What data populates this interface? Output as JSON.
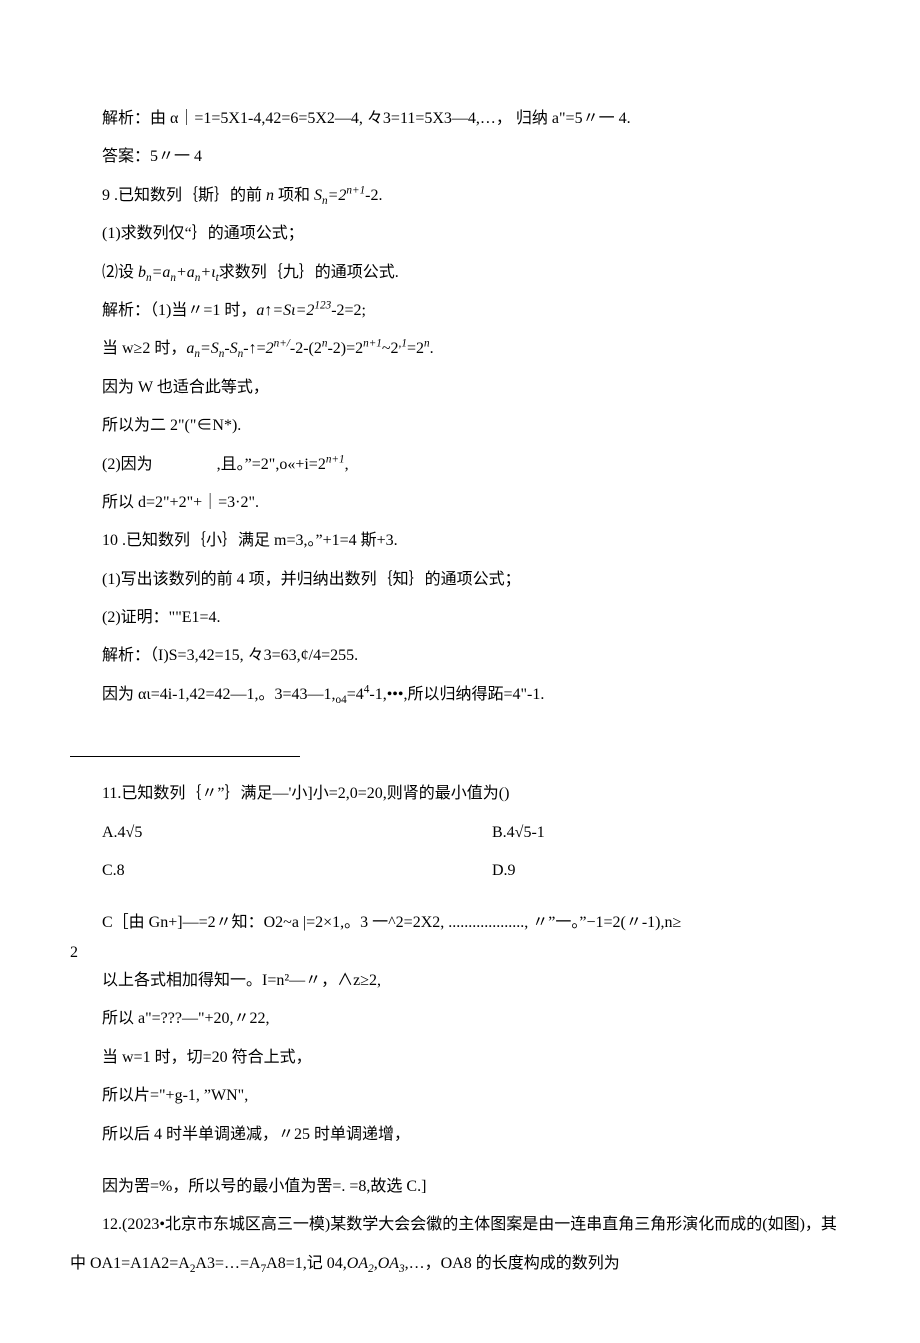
{
  "p01": "解析：由 α｜=1=5X1-4,42=6=5X2—4, 々3=11=5X3—4,…， 归纳 a\"=5〃一 4.",
  "p02": "答案：5〃一 4",
  "p03_a": "9 .已知数列｛斯｝的前 ",
  "p03_b": " 项和 ",
  "p03_c": "-2.",
  "p04": "(1)求数列仅“｝的通项公式；",
  "p05_a": "⑵设 ",
  "p05_b": "求数列｛九｝的通项公式.",
  "p06_a": "解析：（1)当〃=1 时，",
  "p06_b": "-2=2;",
  "p07_a": "当 w≥2 时，",
  "p07_b": "-↑=",
  "p07_c": "-2-(2",
  "p07_d": "-2)=2",
  "p07_e": "~2",
  "p07_f": "=2",
  "p07_g": ".",
  "p08": "因为 W 也适合此等式，",
  "p09": "所以为二 2\"(\"∈N*).",
  "p10_a": "(2)因为",
  "p10_b": ",且。”=2\",o«+i=2",
  "p10_c": ",",
  "p11": "所以 d=2\"+2\"+｜=3·2\".",
  "p12": "10 .已知数列｛小｝满足 m=3,。”+1=4 斯+3.",
  "p13": "(1)写出该数列的前 4 项，并归纳出数列｛知｝的通项公式；",
  "p14": "(2)证明：\"\"E1=4.",
  "p15": "解析：（I)S=3,42=15, 々3=63,¢/4=255.",
  "p16_a": "因为 αι=4i-1,42=42—1,。3=43—1,",
  "p16_b": "=4",
  "p16_c": "-1,•••,所以归纳得跖=4\"-1.",
  "q11_stem": "11.已知数列｛〃”｝满足—'小]小=2,0=20,则肾的最小值为()",
  "q11_A": "A.4√5",
  "q11_B": "B.4√5-1",
  "q11_C": "C.8",
  "q11_D": "D.9",
  "q11_sol1": "C［由 Gn+]—=2〃知：O2~a |=2×1,。3 一^2=2X2, ..................., 〃”一。”−1=2(〃-1),n≥",
  "q11_sol1_tail": "2",
  "q11_sol2": "以上各式相加得知一。I=n²—〃，∧z≥2,",
  "q11_sol3": "所以 a\"=???—\"+20,〃22,",
  "q11_sol4": "当 w=1 时，切=20 符合上式，",
  "q11_sol5": "所以片=\"+g-1, ”WN\",",
  "q11_sol6": "所以后 4 时半单调递减，〃25 时单调递增，",
  "q11_sol7": "因为罟=%，所以号的最小值为罟=. =8,故选 C.]",
  "q12_a": "12.(2023•北京市东城区高三一模)某数学大会会徽的主体图案是由一连串直角三角形演化而成的(如图)，其中 OA1=A1A2=A",
  "q12_b": "A3=…=A",
  "q12_c": "A8=1,记 04,",
  "q12_d": ",…，OA8 的长度构成的数列为"
}
